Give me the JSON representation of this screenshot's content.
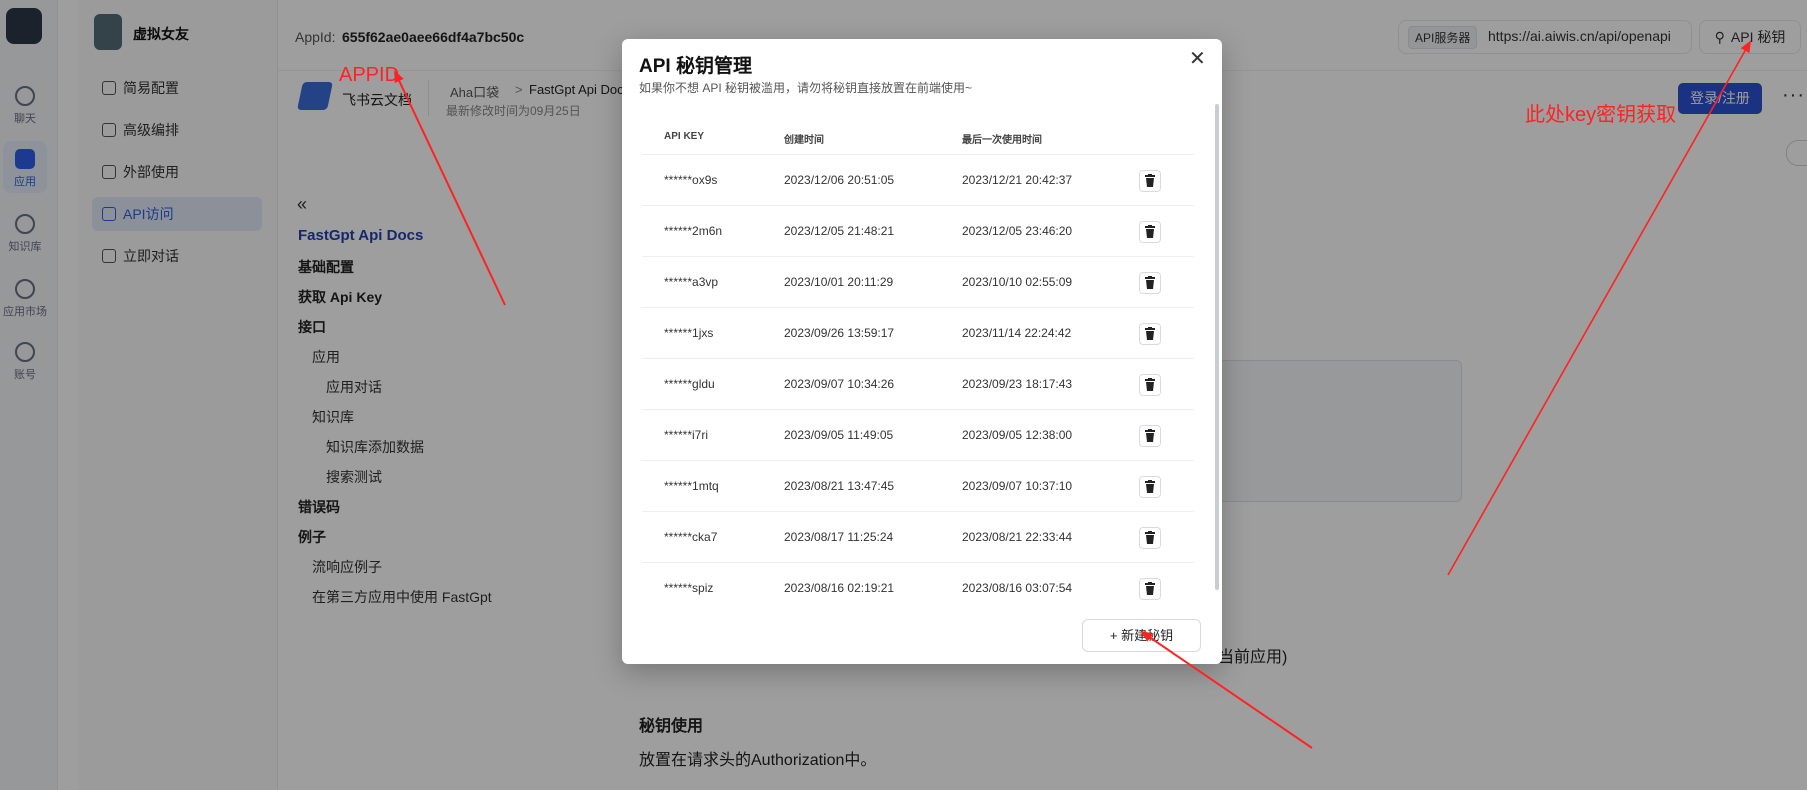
{
  "rail": {
    "items": [
      {
        "label": "聊天",
        "icon": "chat-icon"
      },
      {
        "label": "应用",
        "icon": "cube-icon"
      },
      {
        "label": "知识库",
        "icon": "database-icon"
      },
      {
        "label": "应用市场",
        "icon": "apps-grid-icon"
      },
      {
        "label": "账号",
        "icon": "user-icon"
      }
    ]
  },
  "app": {
    "name": "虚拟女友",
    "menu": [
      {
        "label": "简易配置",
        "icon": "chart-icon"
      },
      {
        "label": "高级编排",
        "icon": "settings-icon"
      },
      {
        "label": "外部使用",
        "icon": "share-icon"
      },
      {
        "label": "API访问",
        "icon": "api-icon"
      },
      {
        "label": "立即对话",
        "icon": "chat-icon"
      }
    ]
  },
  "topbar": {
    "appid_label": "AppId:",
    "appid_value": "655f62ae0aee66df4a7bc50c",
    "api_server_tag": "API服务器",
    "api_server_url": "https://ai.aiwis.cn/api/openapi",
    "api_key_button": "API 秘钥"
  },
  "doc_header": {
    "brand": "飞书云文档",
    "crumb1": "Aha口袋",
    "crumb_sep": ">",
    "crumb2": "FastGpt Api Doc",
    "last_modified": "最新修改时间为09月25日",
    "login_button": "登录/注册",
    "more": "···"
  },
  "doc_nav": {
    "collapse": "«",
    "title": "FastGpt Api Docs",
    "items": [
      {
        "label": "基础配置",
        "level": 0
      },
      {
        "label": "获取 Api Key",
        "level": 0
      },
      {
        "label": "接口",
        "level": 0
      },
      {
        "label": "应用",
        "level": 1
      },
      {
        "label": "应用对话",
        "level": 2
      },
      {
        "label": "知识库",
        "level": 1
      },
      {
        "label": "知识库添加数据",
        "level": 2
      },
      {
        "label": "搜索测试",
        "level": 2
      },
      {
        "label": "错误码",
        "level": 0
      },
      {
        "label": "例子",
        "level": 0
      },
      {
        "label": "流响应例子",
        "level": 1
      },
      {
        "label": "在第三方应用中使用 FastGpt",
        "level": 1
      }
    ]
  },
  "content": {
    "current_app_tail": "当前应用)",
    "secret_use_heading": "秘钥使用",
    "secret_use_text": "放置在请求头的Authorization中。"
  },
  "modal": {
    "title": "API 秘钥管理",
    "subtitle": "如果你不想 API 秘钥被滥用，请勿将秘钥直接放置在前端使用~",
    "close": "✕",
    "columns": [
      "API KEY",
      "创建时间",
      "最后一次使用时间"
    ],
    "rows": [
      {
        "key": "******ox9s",
        "created": "2023/12/06 20:51:05",
        "last_used": "2023/12/21 20:42:37"
      },
      {
        "key": "******2m6n",
        "created": "2023/12/05 21:48:21",
        "last_used": "2023/12/05 23:46:20"
      },
      {
        "key": "******a3vp",
        "created": "2023/10/01 20:11:29",
        "last_used": "2023/10/10 02:55:09"
      },
      {
        "key": "******1jxs",
        "created": "2023/09/26 13:59:17",
        "last_used": "2023/11/14 22:24:42"
      },
      {
        "key": "******gldu",
        "created": "2023/09/07 10:34:26",
        "last_used": "2023/09/23 18:17:43"
      },
      {
        "key": "******i7ri",
        "created": "2023/09/05 11:49:05",
        "last_used": "2023/09/05 12:38:00"
      },
      {
        "key": "******1mtq",
        "created": "2023/08/21 13:47:45",
        "last_used": "2023/09/07 10:37:10"
      },
      {
        "key": "******cka7",
        "created": "2023/08/17 11:25:24",
        "last_used": "2023/08/21 22:33:44"
      },
      {
        "key": "******spiz",
        "created": "2023/08/16 02:19:21",
        "last_used": "2023/08/16 03:07:54"
      }
    ],
    "new_key_button": "+ 新建秘钥"
  },
  "annotations": {
    "appid": "APPID",
    "key": "此处key密钥获取",
    "color": "#ff2222"
  }
}
